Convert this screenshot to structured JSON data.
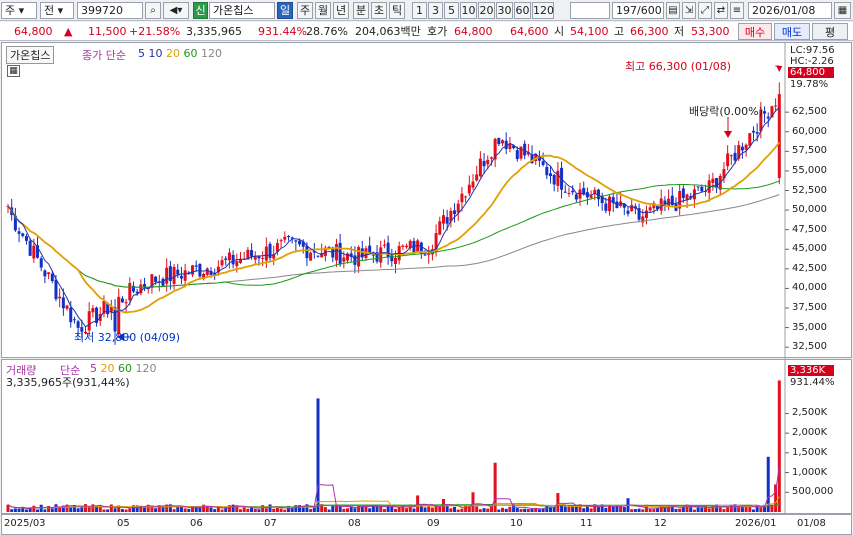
{
  "toolbar": {
    "market": "주",
    "market2": "전",
    "code": "399720",
    "search_icon": "search-icon",
    "sound_icon": "speaker-icon",
    "credit_badge": "신",
    "stock_name": "가온칩스",
    "period_buttons": [
      "일",
      "주",
      "월",
      "년",
      "분",
      "초",
      "틱"
    ],
    "active_period": "일",
    "interval_buttons": [
      "1",
      "3",
      "5",
      "10",
      "20",
      "30",
      "60",
      "120"
    ],
    "page_counter": "197/600",
    "date": "2026/01/08"
  },
  "quote": {
    "price": "64,800",
    "change_arrow": "▲",
    "change": "11,500",
    "change_pct": "+21.58%",
    "volume": "3,335,965",
    "volume_ratio": "931.44%",
    "turnover_rate": "28.76%",
    "amount": "204,063백만",
    "bid_label": "호가",
    "ask_price": "64,800",
    "bid_price": "64,600",
    "open_label": "시",
    "open": "54,100",
    "high_label": "고",
    "high": "66,300",
    "low_label": "저",
    "low": "53,300",
    "buy_label": "매수",
    "sell_label": "매도",
    "eval_label": "평"
  },
  "price_panel": {
    "name": "가온칩스",
    "indicator": "종가 단순",
    "periods": [
      "5",
      "10",
      "20",
      "60",
      "120"
    ],
    "period_colors": [
      "#2233aa",
      "#e0a000",
      "#1a9a1a",
      "#888888"
    ],
    "lc": "LC:97.56",
    "hc": "HC:-2.26",
    "current_price": "64,800",
    "current_pct": "19.78%",
    "high_note": "최고 66,300 (01/08)",
    "low_note": "최저 32,800 (04/09)",
    "dividend_note": "배당락(0.00%)",
    "ticks": [
      "62,500",
      "60,000",
      "57,500",
      "55,000",
      "52,500",
      "50,000",
      "47,500",
      "45,000",
      "42,500",
      "40,000",
      "37,500",
      "35,000",
      "32,500"
    ]
  },
  "volume_panel": {
    "name": "거래량",
    "indicator": "단순",
    "periods": [
      "5",
      "20",
      "60",
      "120"
    ],
    "period_colors": [
      "#aa33aa",
      "#e0a000",
      "#1a9a1a",
      "#888888"
    ],
    "current": "3,335,965주(931,44%)",
    "last": "3,336K",
    "last_pct": "931.44%",
    "ticks": [
      "2,500K",
      "2,000K",
      "1,500K",
      "1,000K",
      "500,000"
    ]
  },
  "x_axis": [
    "2025/03",
    "05",
    "06",
    "07",
    "08",
    "09",
    "10",
    "11",
    "12",
    "2026/01",
    "01/08"
  ],
  "chart_data": {
    "type": "candlestick",
    "title": "가온칩스 일봉",
    "y_range": [
      31500,
      67500
    ],
    "highlights": [
      {
        "label": "최고",
        "value": 66300,
        "date": "01/08"
      },
      {
        "label": "최저",
        "value": 32800,
        "date": "04/09"
      }
    ],
    "close_month_anchors": [
      {
        "month": "2025/03",
        "close": 50000
      },
      {
        "month": "04",
        "close": 35000
      },
      {
        "month": "05",
        "close": 41000
      },
      {
        "month": "06",
        "close": 43000
      },
      {
        "month": "07",
        "close": 45500
      },
      {
        "month": "08",
        "close": 44000
      },
      {
        "month": "09",
        "close": 45500
      },
      {
        "month": "10",
        "close": 59500
      },
      {
        "month": "11",
        "close": 53000
      },
      {
        "month": "12",
        "close": 49000
      },
      {
        "month": "2026/01",
        "close": 52800
      },
      {
        "month": "01/08",
        "close": 64800
      }
    ],
    "volume_range": [
      0,
      3500000
    ],
    "volume_last": 3335965
  }
}
